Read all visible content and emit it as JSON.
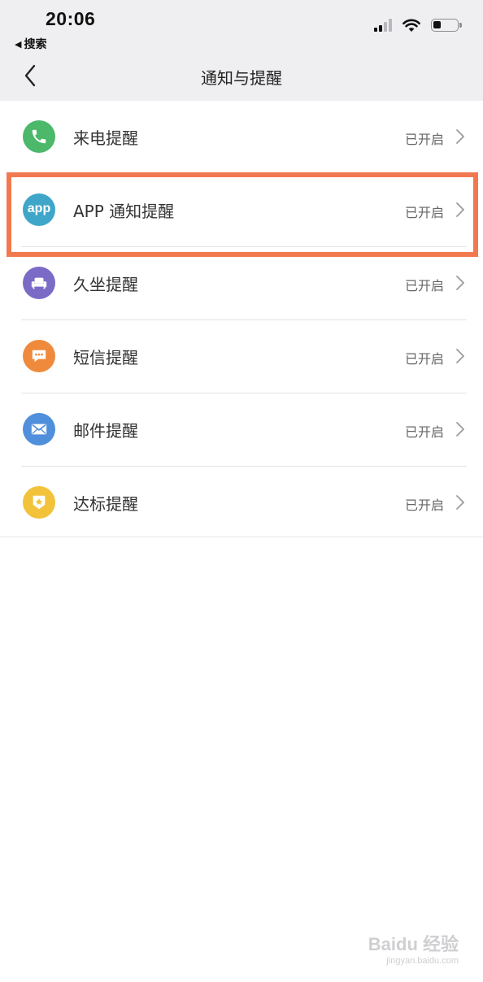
{
  "status_bar": {
    "time": "20:06",
    "back_app": "搜索",
    "back_app_arrow": "◀"
  },
  "nav": {
    "title": "通知与提醒"
  },
  "items": [
    {
      "label": "来电提醒",
      "status": "已开启",
      "icon": "phone-icon",
      "color": "#4cb86a"
    },
    {
      "label": "APP 通知提醒",
      "status": "已开启",
      "icon": "app-icon",
      "icon_text": "app",
      "color": "#3fa6c9"
    },
    {
      "label": "久坐提醒",
      "status": "已开启",
      "icon": "sofa-icon",
      "color": "#7b6bc6"
    },
    {
      "label": "短信提醒",
      "status": "已开启",
      "icon": "message-icon",
      "color": "#ef8a3c"
    },
    {
      "label": "邮件提醒",
      "status": "已开启",
      "icon": "mail-icon",
      "color": "#4f8fdb"
    },
    {
      "label": "达标提醒",
      "status": "已开启",
      "icon": "badge-star-icon",
      "color": "#f2c33a"
    }
  ],
  "highlight_color": "#f2794f",
  "watermark": {
    "main": "Baidu 经验",
    "sub": "jingyan.baidu.com"
  }
}
